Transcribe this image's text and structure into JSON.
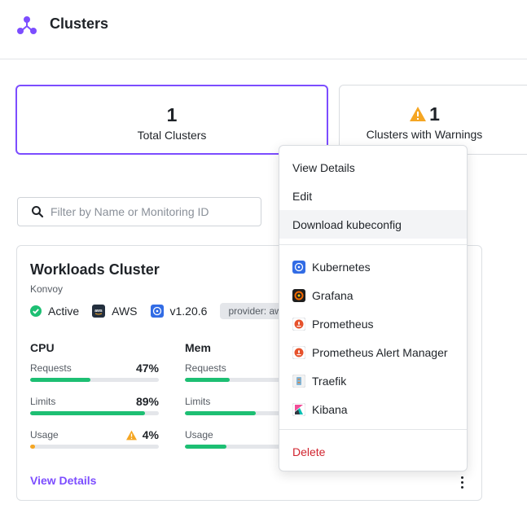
{
  "header": {
    "title": "Clusters",
    "logo_icon": "cluster-logo-icon"
  },
  "stats": [
    {
      "value": "1",
      "label": "Total Clusters"
    },
    {
      "value": "1",
      "label": "Clusters with Warnings",
      "icon": "warning-icon"
    }
  ],
  "filter": {
    "placeholder": "Filter by Name or Monitoring ID",
    "value": ""
  },
  "cluster": {
    "name": "Workloads Cluster",
    "distribution": "Konvoy",
    "status": "Active",
    "cloud": "AWS",
    "version": "v1.20.6",
    "provider_label": "provider: aws",
    "metrics": {
      "cpu": {
        "title": "CPU",
        "requests": {
          "label": "Requests",
          "value": "47%",
          "fraction": 0.47
        },
        "limits": {
          "label": "Limits",
          "value": "89%",
          "fraction": 0.89
        },
        "usage": {
          "label": "Usage",
          "value": "4%",
          "fraction": 0.04,
          "warning": true
        }
      },
      "mem": {
        "title": "Mem",
        "requests": {
          "label": "Requests",
          "fraction": 0.35
        },
        "limits": {
          "label": "Limits",
          "fraction": 0.55
        },
        "usage": {
          "label": "Usage",
          "fraction": 0.32
        }
      }
    },
    "view_details": "View Details"
  },
  "menu": {
    "actions": [
      "View Details",
      "Edit",
      "Download kubeconfig"
    ],
    "links": [
      {
        "label": "Kubernetes",
        "icon": "kubernetes-icon"
      },
      {
        "label": "Grafana",
        "icon": "grafana-icon"
      },
      {
        "label": "Prometheus",
        "icon": "prometheus-icon"
      },
      {
        "label": "Prometheus Alert Manager",
        "icon": "prometheus-icon"
      },
      {
        "label": "Traefik",
        "icon": "traefik-icon"
      },
      {
        "label": "Kibana",
        "icon": "kibana-icon"
      }
    ],
    "delete": "Delete"
  },
  "colors": {
    "accent": "#7c4dff",
    "success": "#1dbf73",
    "warning": "#f5a623",
    "danger": "#d1242f"
  }
}
